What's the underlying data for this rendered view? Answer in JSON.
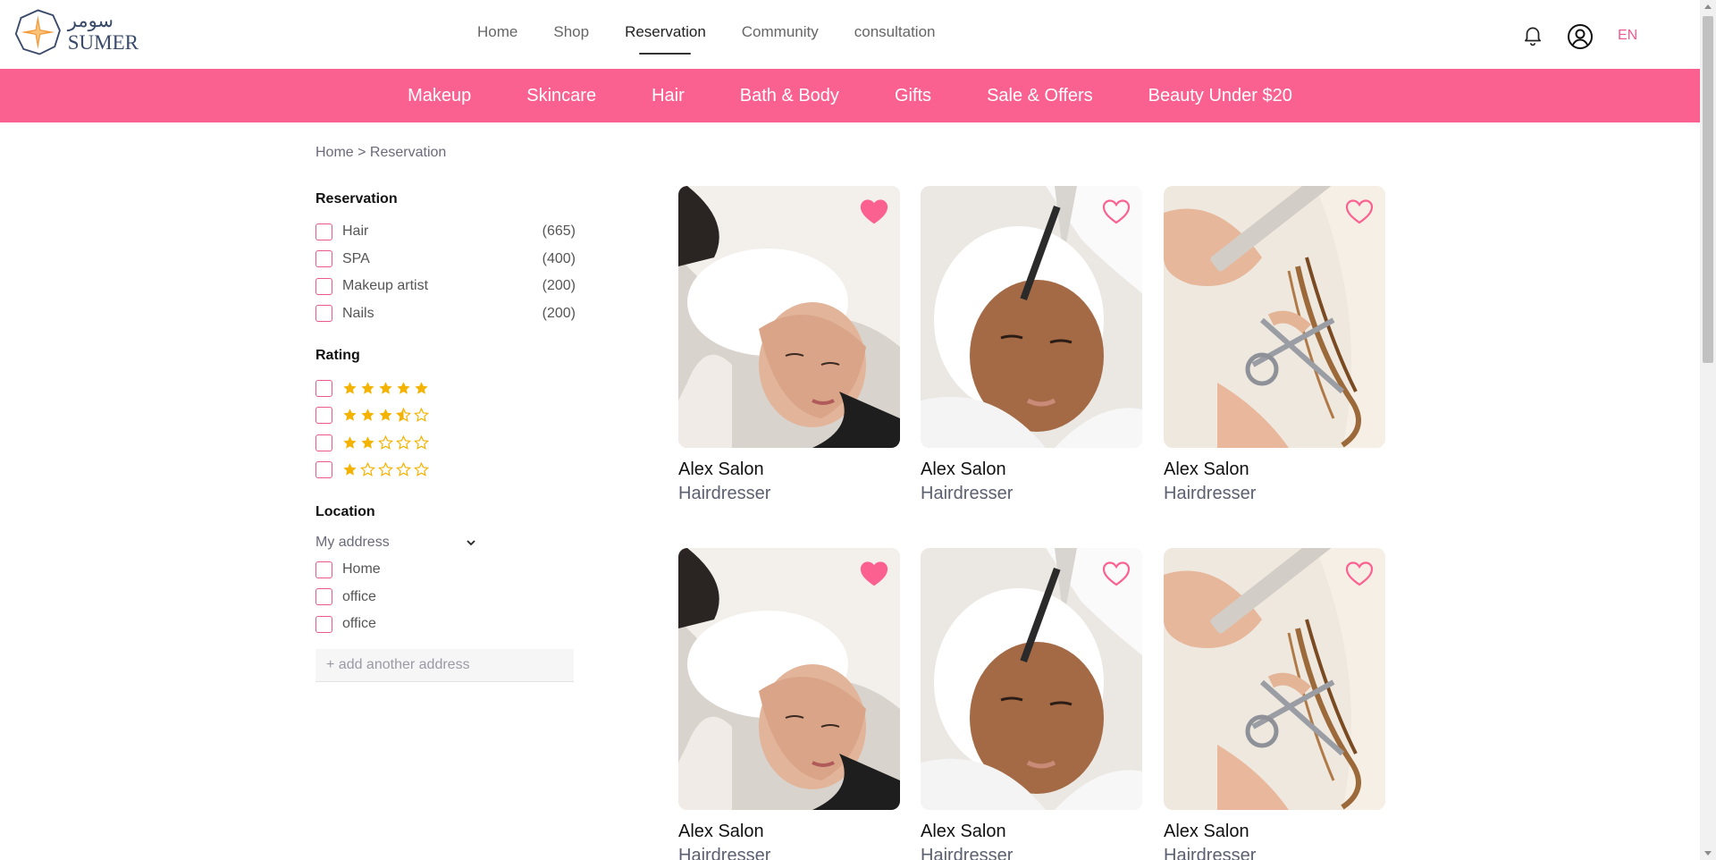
{
  "brand": {
    "name_ar": "سومر",
    "name_en": "SUMER"
  },
  "nav": {
    "items": [
      "Home",
      "Shop",
      "Reservation",
      "Community",
      "consultation"
    ],
    "active": "Reservation"
  },
  "header": {
    "language": "EN"
  },
  "categories": [
    "Makeup",
    "Skincare",
    "Hair",
    "Bath & Body",
    "Gifts",
    "Sale & Offers",
    "Beauty Under $20"
  ],
  "breadcrumb": "Home > Reservation",
  "filters": {
    "reservation": {
      "title": "Reservation",
      "options": [
        {
          "label": "Hair",
          "count": "(665)"
        },
        {
          "label": "SPA",
          "count": "(400)"
        },
        {
          "label": "Makeup artist",
          "count": "(200)"
        },
        {
          "label": "Nails",
          "count": "(200)"
        }
      ]
    },
    "rating": {
      "title": "Rating",
      "options": [
        5,
        3.5,
        2,
        1
      ],
      "max": 5
    },
    "location": {
      "title": "Location",
      "select_value": "My address",
      "options": [
        "Home",
        "office",
        "office"
      ],
      "add_button": "+ add another address"
    }
  },
  "cards": [
    {
      "name": "Alex Salon",
      "type": "Hairdresser",
      "photo": "hair-wash-photo",
      "favorite": true
    },
    {
      "name": "Alex Salon",
      "type": "Hairdresser",
      "photo": "facial-mask-photo",
      "favorite": false
    },
    {
      "name": "Alex Salon",
      "type": "Hairdresser",
      "photo": "hair-cut-photo",
      "favorite": false
    },
    {
      "name": "Alex Salon",
      "type": "Hairdresser",
      "photo": "hair-wash-photo",
      "favorite": true
    },
    {
      "name": "Alex Salon",
      "type": "Hairdresser",
      "photo": "facial-mask-photo",
      "favorite": false
    },
    {
      "name": "Alex Salon",
      "type": "Hairdresser",
      "photo": "hair-cut-photo",
      "favorite": false
    }
  ],
  "colors": {
    "accent": "#fb6190",
    "checkbox_border": "#e75a8a",
    "star": "#f5b301",
    "heart": "#fb6190"
  }
}
